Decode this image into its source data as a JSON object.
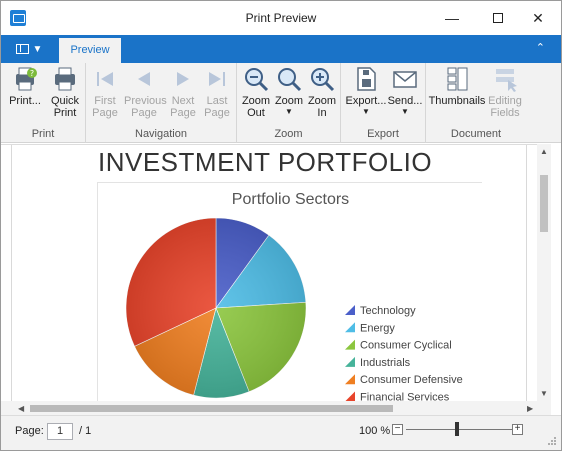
{
  "window": {
    "title": "Print Preview"
  },
  "ribbon": {
    "tab": "Preview",
    "groups": [
      {
        "label": "Print",
        "buttons": [
          {
            "label": "Print...",
            "icon": "printer-options-icon",
            "disabled": false
          },
          {
            "label": "Quick\nPrint",
            "icon": "quick-print-icon",
            "disabled": false
          }
        ]
      },
      {
        "label": "Navigation",
        "buttons": [
          {
            "label": "First\nPage",
            "icon": "first-page-icon",
            "disabled": true
          },
          {
            "label": "Previous\nPage",
            "icon": "previous-page-icon",
            "disabled": true
          },
          {
            "label": "Next\nPage",
            "icon": "next-page-icon",
            "disabled": true
          },
          {
            "label": "Last\nPage",
            "icon": "last-page-icon",
            "disabled": true
          }
        ]
      },
      {
        "label": "Zoom",
        "buttons": [
          {
            "label": "Zoom\nOut",
            "icon": "zoom-out-icon",
            "disabled": false
          },
          {
            "label": "Zoom",
            "icon": "zoom-icon",
            "disabled": false,
            "dropdown": true
          },
          {
            "label": "Zoom\nIn",
            "icon": "zoom-in-icon",
            "disabled": false
          }
        ]
      },
      {
        "label": "Export",
        "buttons": [
          {
            "label": "Export...",
            "icon": "export-icon",
            "disabled": false,
            "dropdown": true
          },
          {
            "label": "Send...",
            "icon": "send-email-icon",
            "disabled": false,
            "dropdown": true
          }
        ]
      },
      {
        "label": "Document",
        "buttons": [
          {
            "label": "Thumbnails",
            "icon": "thumbnails-icon",
            "disabled": false
          },
          {
            "label": "Editing\nFields",
            "icon": "editing-fields-icon",
            "disabled": true
          }
        ]
      }
    ]
  },
  "document": {
    "title": "INVESTMENT PORTFOLIO",
    "chart_data": {
      "type": "pie",
      "title": "Portfolio Sectors",
      "categories": [
        "Technology",
        "Energy",
        "Consumer Cyclical",
        "Industrials",
        "Consumer Defensive",
        "Financial Services"
      ],
      "values": [
        10,
        14,
        20,
        10,
        14,
        32
      ],
      "colors": [
        "#4b5fc9",
        "#4fbde6",
        "#8cc63f",
        "#46b39a",
        "#ef7f22",
        "#e8452c"
      ],
      "legend_position": "right"
    }
  },
  "status": {
    "page_label": "Page:",
    "page_current": "1",
    "page_total": "/ 1",
    "zoom": "100 %",
    "zoom_minus": "−",
    "zoom_plus": "+"
  }
}
